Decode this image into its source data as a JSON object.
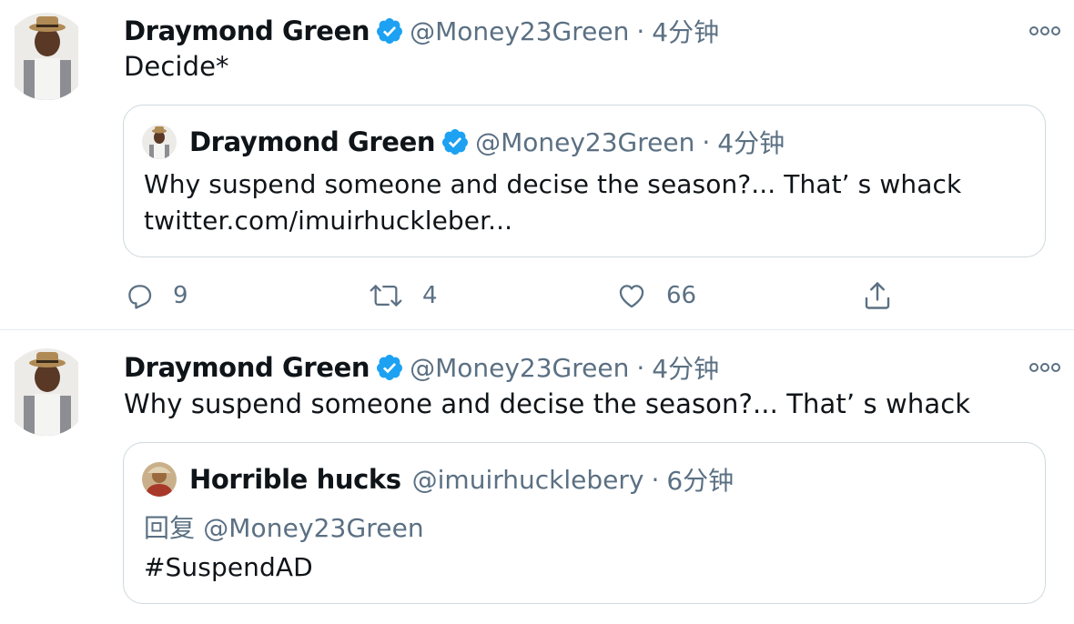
{
  "tweets": [
    {
      "author": {
        "name": "Draymond Green",
        "handle": "@Money23Green",
        "time": "4分钟",
        "separator": "·"
      },
      "text": "Decide*",
      "quote": {
        "author": {
          "name": "Draymond Green",
          "handle": "@Money23Green",
          "time": "4分钟",
          "separator": "·"
        },
        "lines": [
          "Why suspend someone and decise the season?... That’ s whack",
          "twitter.com/imuirhuckleber..."
        ]
      },
      "actions": {
        "reply_count": "9",
        "retweet_count": "4",
        "like_count": "66"
      }
    },
    {
      "author": {
        "name": "Draymond Green",
        "handle": "@Money23Green",
        "time": "4分钟",
        "separator": "·"
      },
      "text": "Why suspend someone and decise the season?... That’ s whack",
      "quote": {
        "author": {
          "name": "Horrible hucks",
          "handle": "@imuirhucklebery",
          "time": "6分钟",
          "separator": "·"
        },
        "reply_to": "回复 @Money23Green",
        "lines": [
          "#SuspendAD"
        ]
      }
    }
  ],
  "icons": {
    "verified": "verified-badge-icon",
    "more": "more-options-icon",
    "reply": "reply-icon",
    "retweet": "retweet-icon",
    "like": "like-icon",
    "share": "share-icon"
  },
  "colors": {
    "verified_blue": "#1da1f2",
    "secondary_text": "#5b7083",
    "border": "#cfd9de"
  }
}
